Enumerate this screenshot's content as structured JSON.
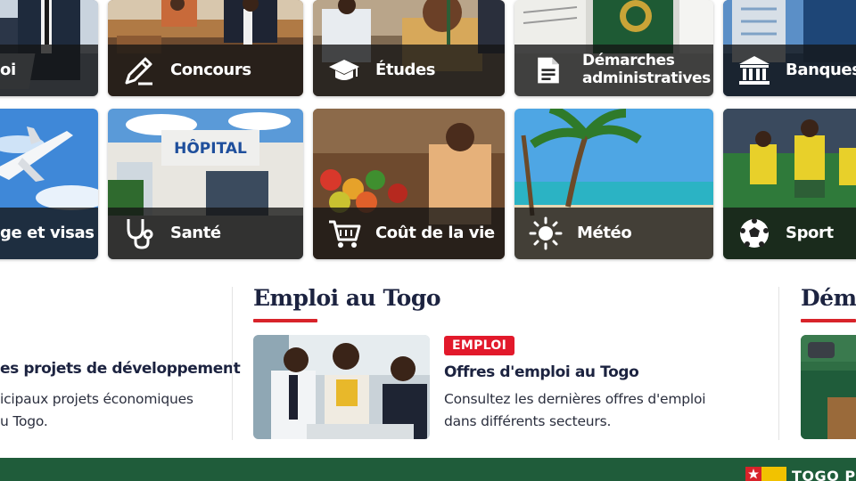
{
  "category_tiles": [
    {
      "label": "oi",
      "icon": "laptop-icon"
    },
    {
      "label": "Concours",
      "icon": "pencil-edit-icon"
    },
    {
      "label": "Études",
      "icon": "graduation-cap-icon"
    },
    {
      "label_line1": "Démarches",
      "label_line2": "administratives",
      "icon": "document-icon"
    },
    {
      "label": "Banques e",
      "icon": "bank-icon"
    },
    {
      "label": "ge et visas",
      "icon": "plane-icon"
    },
    {
      "label": "Santé",
      "icon": "stethoscope-icon"
    },
    {
      "label": "Coût de la vie",
      "icon": "shopping-cart-icon"
    },
    {
      "label": "Météo",
      "icon": "sun-icon"
    },
    {
      "label": "Sport",
      "icon": "soccer-ball-icon"
    }
  ],
  "tile_images": {
    "hopital_sign": "HÔPITAL"
  },
  "left_section": {
    "article_title": "es projets de développement",
    "desc_line1": "icipaux projets économiques",
    "desc_line2": "u Togo."
  },
  "emploi_section": {
    "title": "Emploi au Togo",
    "badge": "EMPLOI",
    "article_title": "Offres d'emploi au Togo",
    "desc_line1": "Consultez les dernières offres d'emploi",
    "desc_line2": "dans différents secteurs."
  },
  "right_section": {
    "title": "Déma"
  },
  "footer": {
    "logo_text": "TOGO PR"
  },
  "colors": {
    "accent_red": "#d8232a",
    "badge_red": "#e2192b",
    "footer_green": "#1f5c3a",
    "title_navy": "#1c2340"
  }
}
